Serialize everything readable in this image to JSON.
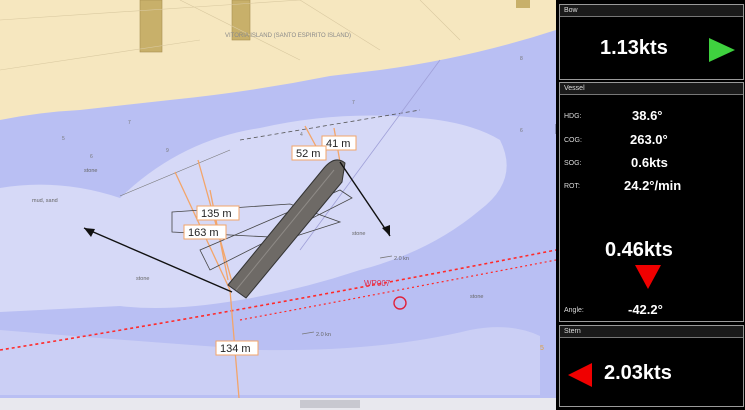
{
  "map": {
    "island_label": "VITORIA ISLAND (SANTO ESPIRITO ISLAND)",
    "waypoint_label": "WP007",
    "bottom_labels": [
      "mud, sand",
      "stone",
      "stone",
      "stone",
      "stone"
    ],
    "current_labels": [
      "2.0 kn",
      "2.0 kn"
    ],
    "depths": [
      "5",
      "7",
      "7",
      "6",
      "9",
      "4",
      "6",
      "5",
      "8"
    ],
    "distances": {
      "d41": "41 m",
      "d52": "52 m",
      "d135": "135 m",
      "d163": "163 m",
      "d134": "134 m"
    }
  },
  "bow": {
    "title": "Bow",
    "speed": "1.13kts",
    "arrow": "right",
    "arrow_color": "#3fd13f"
  },
  "vessel": {
    "title": "Vessel",
    "hdg_label": "HDG:",
    "hdg": "38.6°",
    "cog_label": "COG:",
    "cog": "263.0°",
    "sog_label": "SOG:",
    "sog": "0.6kts",
    "rot_label": "ROT:",
    "rot": "24.2°/min",
    "lateral_speed": "0.46kts",
    "arrow": "down",
    "arrow_color": "#f00000",
    "angle_label": "Angle:",
    "angle": "-42.2°"
  },
  "stern": {
    "title": "Stern",
    "speed": "2.03kts",
    "arrow": "left",
    "arrow_color": "#f00000"
  }
}
